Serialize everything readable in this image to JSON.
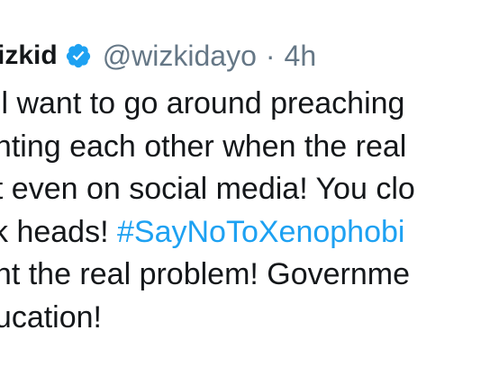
{
  "tweet": {
    "display_name": "izkid",
    "handle": "@wizkidayo",
    "separator": "·",
    "time": "4h",
    "verified_color": "#1da1f2",
    "lines": [
      {
        "text": "all want to go around preaching"
      },
      {
        "text": "ghting each other when the real"
      },
      {
        "text": "ot even on social media! You clo"
      },
      {
        "text": "ck heads! ",
        "hashtag": "#SayNoToXenophobi"
      },
      {
        "text": "ght the real problem! Governme"
      },
      {
        "text": "ducation!"
      }
    ]
  }
}
